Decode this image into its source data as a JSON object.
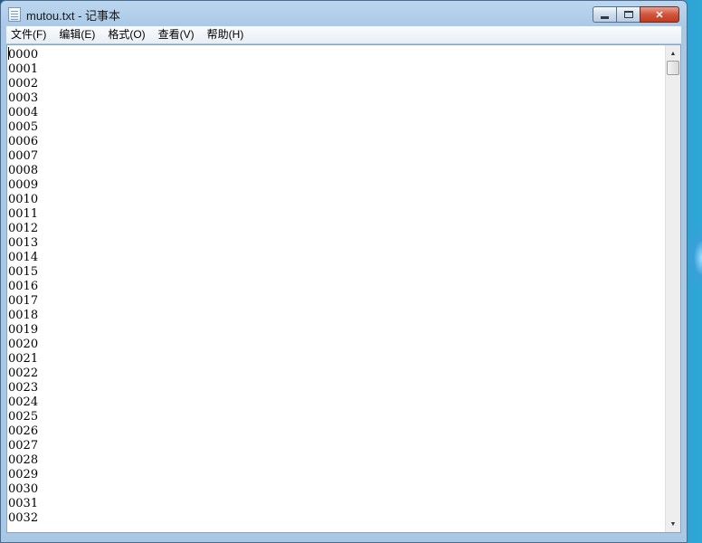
{
  "window": {
    "title": "mutou.txt - 记事本",
    "buttons": {
      "minimize": "",
      "maximize": "",
      "close": "✕"
    }
  },
  "menu": [
    {
      "label": "文件(F)"
    },
    {
      "label": "编辑(E)"
    },
    {
      "label": "格式(O)"
    },
    {
      "label": "查看(V)"
    },
    {
      "label": "帮助(H)"
    }
  ],
  "editor": {
    "lines": [
      "0000",
      "0001",
      "0002",
      "0003",
      "0004",
      "0005",
      "0006",
      "0007",
      "0008",
      "0009",
      "0010",
      "0011",
      "0012",
      "0013",
      "0014",
      "0015",
      "0016",
      "0017",
      "0018",
      "0019",
      "0020",
      "0021",
      "0022",
      "0023",
      "0024",
      "0025",
      "0026",
      "0027",
      "0028",
      "0029",
      "0030",
      "0031",
      "0032"
    ]
  },
  "icons": {
    "app": "notepad-icon",
    "scroll_up": "scroll-up-arrow-icon",
    "scroll_down": "scroll-down-arrow-icon"
  }
}
